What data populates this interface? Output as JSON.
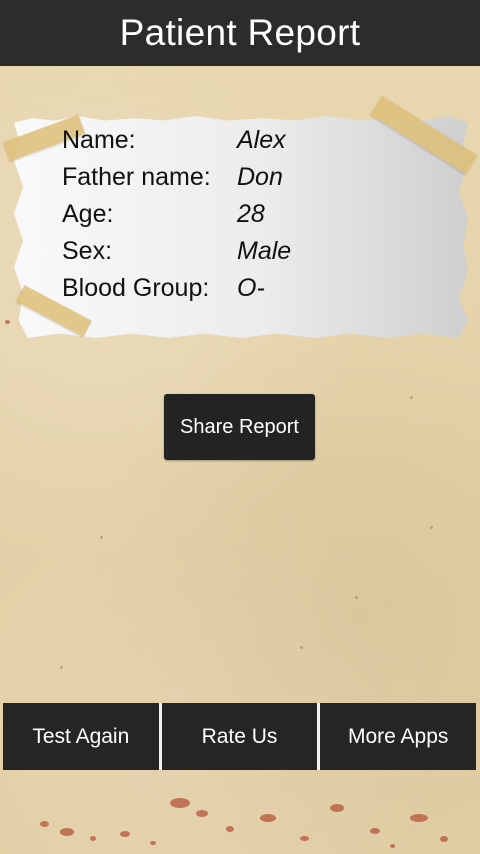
{
  "header": {
    "title": "Patient Report"
  },
  "patient": {
    "rows": [
      {
        "label": "Name:",
        "value": "Alex"
      },
      {
        "label": "Father name:",
        "value": "Don"
      },
      {
        "label": "Age:",
        "value": "28"
      },
      {
        "label": "Sex:",
        "value": "Male"
      },
      {
        "label": "Blood Group:",
        "value": "O-"
      }
    ]
  },
  "actions": {
    "share_label": "Share Report"
  },
  "bottom_bar": {
    "test_again": "Test Again",
    "rate_us": "Rate Us",
    "more_apps": "More Apps"
  },
  "colors": {
    "header_bg": "#2d2c2a",
    "button_bg": "#232323",
    "parchment": "#e6d4ad",
    "blood_spot": "#b5543a"
  }
}
